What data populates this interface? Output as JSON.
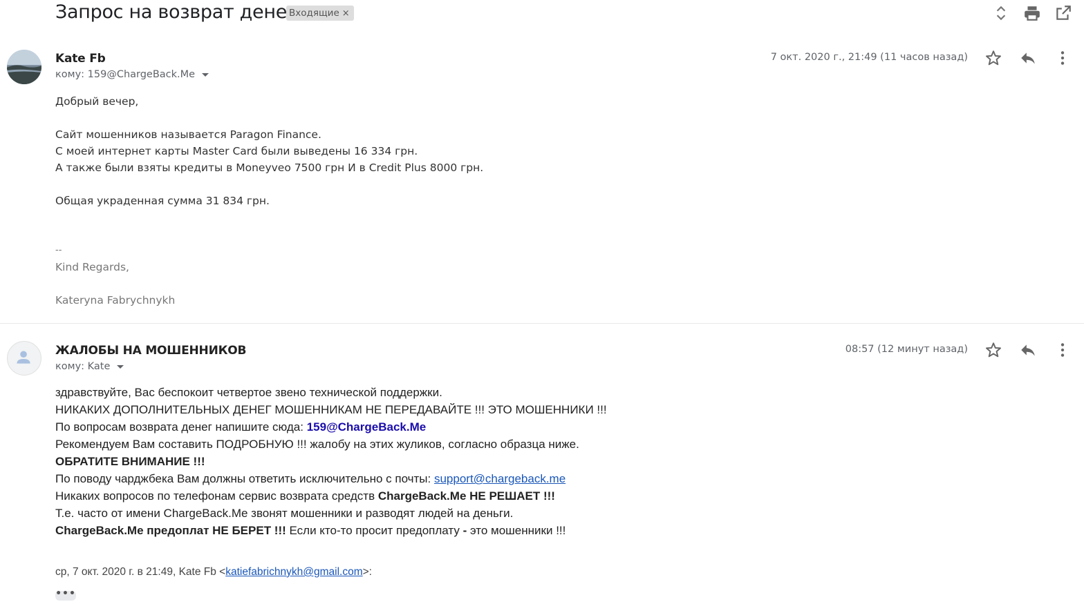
{
  "subject": "Запрос на возврат денег",
  "label": {
    "text": "Входящие",
    "remove": "×"
  },
  "toolbar_icons": [
    "expand-collapse-icon",
    "print-icon",
    "open-in-new-window-icon"
  ],
  "messages": [
    {
      "sender": "Kate Fb",
      "to": "кому: 159@ChargeBack.Me",
      "date": "7 окт. 2020 г., 21:49 (11 часов назад)",
      "body": [
        "Добрый вечер,",
        "",
        "Сайт мошенников называется Paragon Finance.",
        "С моей интернет карты Master Card были выведены 16 334 грн.",
        "А также были взяты кредиты в Moneyveo 7500 грн И в Credit Plus 8000 грн.",
        "",
        "Общая украденная сумма 31 834 грн.",
        "",
        "",
        "--",
        "Kind Regards,",
        "",
        "Kateryna Fabrychnykh"
      ]
    },
    {
      "sender": "ЖАЛОБЫ НА МОШЕННИКОВ",
      "to": "кому: Kate",
      "date": "08:57 (12 минут назад)",
      "body": {
        "l1": "здравствуйте, Вас беспокоит четвертое звено технической поддержки.",
        "l2": "НИКАКИХ ДОПОЛНИТЕЛЬНЫХ ДЕНЕГ МОШЕННИКАМ НЕ ПЕРЕДАВАЙТЕ !!! ЭТО МОШЕННИКИ !!!",
        "l3_prefix": "По вопросам возврата денег напишите сюда: ",
        "l3_link": "159@ChargeBack.Me",
        "l4": "Рекомендуем Вам составить ПОДРОБНУЮ !!! жалобу на этих жуликов, согласно образца ниже.",
        "l5": "ОБРАТИТЕ ВНИМАНИЕ !!!",
        "l6_prefix": "По поводу чарджбека Вам должны ответить исключительно с почты: ",
        "l6_link": "support@chargeback.me",
        "l7_prefix": "Никаких вопросов по телефонам сервис возврата средств ",
        "l7_bold": "ChargeBack.Me НЕ РЕШАЕТ !!!",
        "l8": "Т.е. часто от имени ChargeBack.Me звонят мошенники и разводят людей на деньги.",
        "l9_bold": "ChargeBack.Me предоплат НЕ БЕРЕТ !!!",
        "l9_mid": " Если кто-то просит предоплату ",
        "l9_dash": "-",
        "l9_suffix": " это мошенники !!!"
      },
      "quote": {
        "prefix": "ср, 7 окт. 2020 г. в 21:49, Kate Fb <",
        "email": "katiefabrichnykh@gmail.com",
        "suffix": ">:"
      },
      "show_trimmed": "•••"
    }
  ]
}
